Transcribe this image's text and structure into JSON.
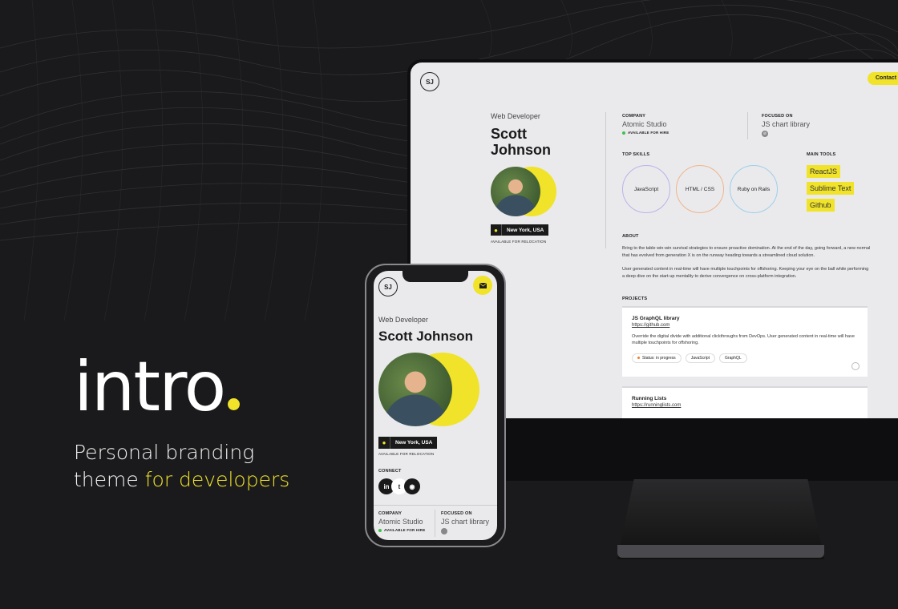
{
  "brand": {
    "logo": "intro",
    "tagline_line1": "Personal branding",
    "tagline_line2_a": "theme ",
    "tagline_line2_b": "for developers"
  },
  "colors": {
    "accent": "#f0e32a",
    "background": "#1a1a1c",
    "screen": "#eaeaed"
  },
  "desktop": {
    "initials": "SJ",
    "contact_button": "Contact m",
    "role": "Web Developer",
    "name_first": "Scott",
    "name_last": "Johnson",
    "location": "New York, USA",
    "relocation": "AVAILABLE FOR RELOCATION",
    "company_label": "COMPANY",
    "company": "Atomic Studio",
    "hire_status": "AVAILABLE FOR HIRE",
    "focused_label": "FOCUSED ON",
    "focused": "JS chart library",
    "top_skills_label": "TOP SKILLS",
    "skills": [
      "JavaScript",
      "HTML / CSS",
      "Ruby on Rails"
    ],
    "main_tools_label": "MAIN TOOLS",
    "tools": [
      "ReactJS",
      "Sublime Text",
      "Github"
    ],
    "about_label": "ABOUT",
    "about_p1": "Bring to the table win-win survival strategies to ensure proactive domination. At the end of the day, going forward, a new normal that has evolved from generation X is on the runway heading towards a streamlined cloud solution.",
    "about_p2": "User generated content in real-time will have multiple touchpoints for offshoring. Keeping your eye on the ball while performing a deep dive on the start-up mentality to derive convergence on cross-platform integration.",
    "projects_label": "PROJECTS",
    "projects": [
      {
        "title": "JS GraphQL library",
        "link": "https://github.com",
        "desc": "Override the digital divide with additional clickthroughs from DevOps. User generated content in real-time will have multiple touchpoints for offshoring.",
        "tags": [
          "Status: in progress",
          "JavaScript",
          "GraphQL"
        ]
      },
      {
        "title": "Running Lists",
        "link": "https://runninglists.com"
      }
    ]
  },
  "mobile": {
    "initials": "SJ",
    "role": "Web Developer",
    "name": "Scott Johnson",
    "location": "New York, USA",
    "relocation": "AVAILABLE FOR RELOCATION",
    "connect_label": "CONNECT",
    "company_label": "COMPANY",
    "company": "Atomic Studio",
    "hire_status": "AVAILABLE FOR HIRE",
    "focused_label": "FOCUSED ON",
    "focused": "JS chart library"
  }
}
